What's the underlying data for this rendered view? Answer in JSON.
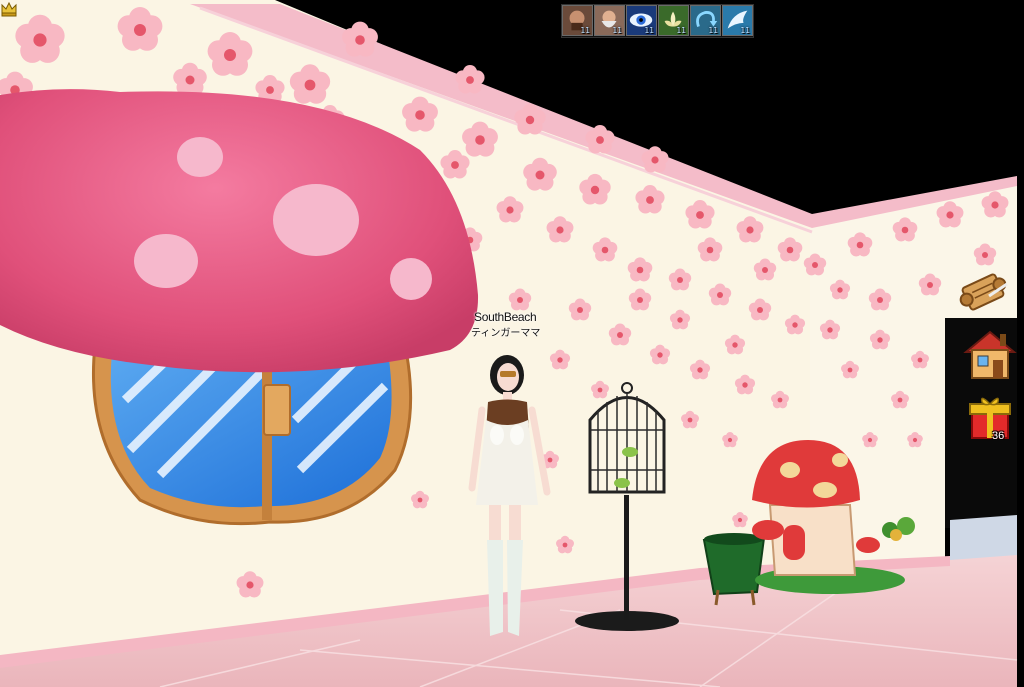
{
  "buffs": [
    {
      "icon": "warrior-portrait-icon",
      "level": "11"
    },
    {
      "icon": "old-man-portrait-icon",
      "level": "11"
    },
    {
      "icon": "eye-icon",
      "level": "11"
    },
    {
      "icon": "lotus-icon",
      "level": "11"
    },
    {
      "icon": "swirl-arrow-icon",
      "level": "11"
    },
    {
      "icon": "wing-icon",
      "level": "11"
    }
  ],
  "player": {
    "name": "SouthBeach",
    "title": "ティンガーママ"
  },
  "side_menu": {
    "scroll_icon": "quest-scroll-icon",
    "house_icon": "house-icon",
    "gift_icon": "gift-box-icon",
    "gift_count": "36"
  },
  "colors": {
    "wall": "#fbf5e4",
    "floor": "#f2c9cc",
    "blossom": "#f6a9b6",
    "mushroom_cap": "#e5577f"
  }
}
